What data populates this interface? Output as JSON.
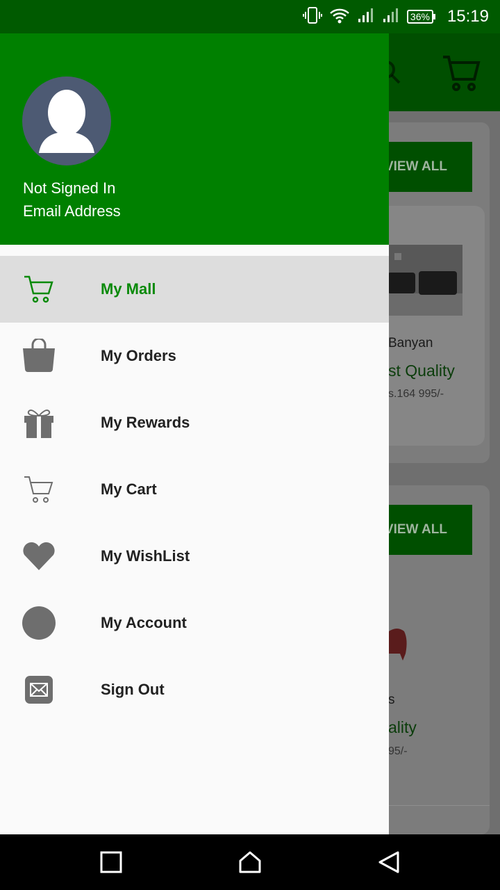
{
  "status_bar": {
    "battery": "36%",
    "time": "15:19",
    "icons": [
      "vibrate-icon",
      "wifi-icon",
      "signal-icon",
      "signal-icon"
    ]
  },
  "background": {
    "view_all_label": "VIEW ALL",
    "product1": {
      "brand": "Banyan",
      "quality": "st Quality",
      "price": "s.164 995/-"
    },
    "product2": {
      "brand": "s",
      "quality": "ality",
      "price": "95/-"
    }
  },
  "drawer": {
    "user_name": "Not Signed In",
    "user_email": "Email Address",
    "menu": [
      {
        "label": "My Mall",
        "icon": "cart-icon",
        "active": true
      },
      {
        "label": "My Orders",
        "icon": "shopping-bag-icon",
        "active": false
      },
      {
        "label": "My Rewards",
        "icon": "gift-icon",
        "active": false
      },
      {
        "label": "My Cart",
        "icon": "cart-icon",
        "active": false
      },
      {
        "label": "My WishList",
        "icon": "heart-icon",
        "active": false
      },
      {
        "label": "My Account",
        "icon": "account-circle-icon",
        "active": false
      },
      {
        "label": "Sign Out",
        "icon": "mail-icon",
        "active": false
      }
    ]
  },
  "colors": {
    "primary": "#008000",
    "status_bar": "#005a00",
    "active_text": "#0a8a0a",
    "icon_gray": "#6e6e6e"
  }
}
